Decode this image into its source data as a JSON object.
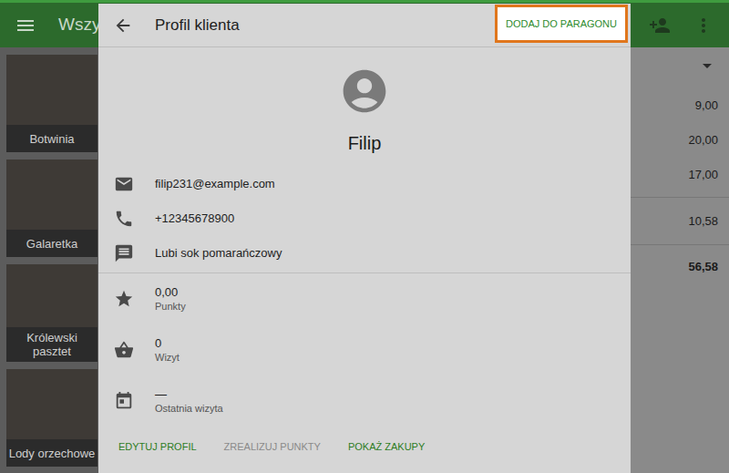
{
  "app_bar": {
    "title": "Wszys"
  },
  "products": [
    {
      "name": "Botwinia"
    },
    {
      "name": "Galaretka"
    },
    {
      "name": "Królewski pasztet"
    },
    {
      "name": "Lody orzechowe"
    }
  ],
  "receipt": {
    "items": [
      "9,00",
      "20,00",
      "17,00"
    ],
    "summary": "10,58",
    "total": "56,58"
  },
  "dialog": {
    "title": "Profil klienta",
    "primary_action": {
      "label": "DODAJ DO PARAGONU",
      "highlighted": true
    },
    "name": "Filip",
    "contacts": [
      {
        "kind": "email",
        "text": "filip231@example.com"
      },
      {
        "kind": "phone",
        "text": "+12345678900"
      },
      {
        "kind": "note",
        "text": "Lubi sok pomarańczowy"
      }
    ],
    "stats": [
      {
        "kind": "points",
        "value": "0,00",
        "label": "Punkty"
      },
      {
        "kind": "visits",
        "value": "0",
        "label": "Wizyt"
      },
      {
        "kind": "last_visit",
        "value": "—",
        "label": "Ostatnia wizyta"
      }
    ],
    "actions": [
      {
        "label": "EDYTUJ PROFIL",
        "disabled": false
      },
      {
        "label": "ZREALIZUJ PUNKTY",
        "disabled": true
      },
      {
        "label": "POKAŻ ZAKUPY",
        "disabled": false
      }
    ]
  }
}
